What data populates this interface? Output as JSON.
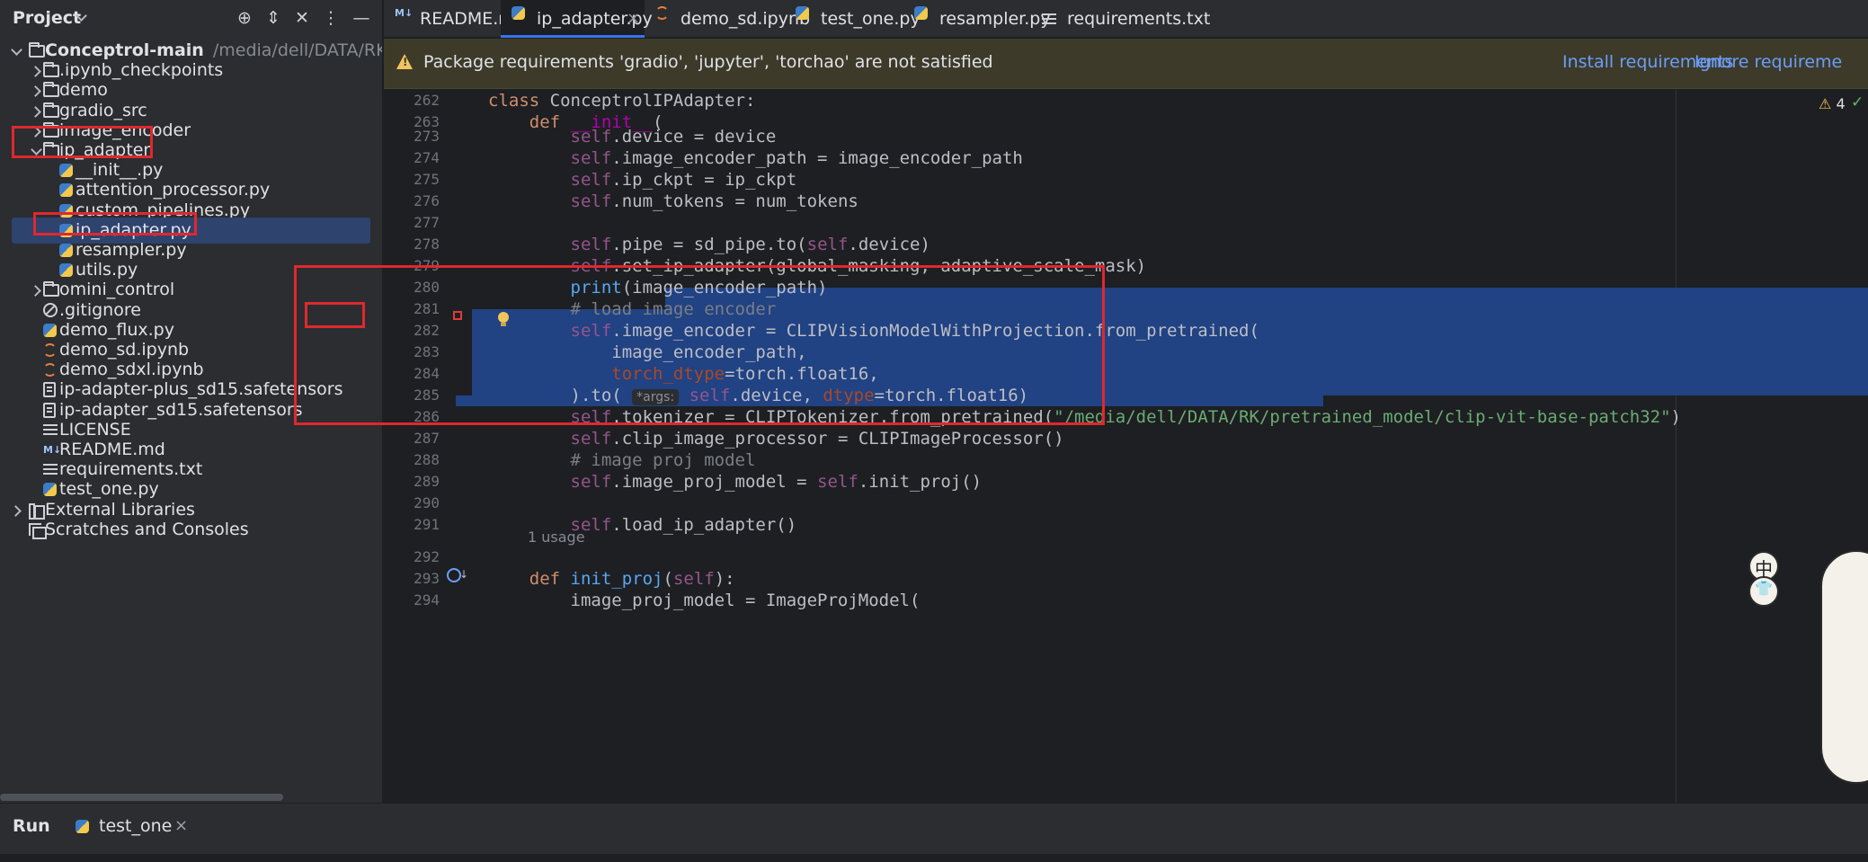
{
  "project": {
    "title": "Project",
    "tree": [
      {
        "label": "Conceptrol-main",
        "path": "/media/dell/DATA/RK/C",
        "kind": "folder",
        "level": 0,
        "arrow": "open"
      },
      {
        "label": ".ipynb_checkpoints",
        "kind": "folder",
        "level": 1,
        "arrow": "closed"
      },
      {
        "label": "demo",
        "kind": "folder",
        "level": 1,
        "arrow": "closed"
      },
      {
        "label": "gradio_src",
        "kind": "folder",
        "level": 1,
        "arrow": "closed"
      },
      {
        "label": "image_encoder",
        "kind": "folder",
        "level": 1,
        "arrow": "closed"
      },
      {
        "label": "ip_adapter",
        "kind": "folder",
        "level": 1,
        "arrow": "open"
      },
      {
        "label": "__init__.py",
        "kind": "py",
        "level": 2
      },
      {
        "label": "attention_processor.py",
        "kind": "py",
        "level": 2
      },
      {
        "label": "custom_pipelines.py",
        "kind": "py",
        "level": 2
      },
      {
        "label": "ip_adapter.py",
        "kind": "py",
        "level": 2,
        "selected": true
      },
      {
        "label": "resampler.py",
        "kind": "py",
        "level": 2
      },
      {
        "label": "utils.py",
        "kind": "py",
        "level": 2
      },
      {
        "label": "omini_control",
        "kind": "folder",
        "level": 1,
        "arrow": "closed"
      },
      {
        "label": ".gitignore",
        "kind": "ban",
        "level": 1
      },
      {
        "label": "demo_flux.py",
        "kind": "py",
        "level": 1
      },
      {
        "label": "demo_sd.ipynb",
        "kind": "nb",
        "level": 1
      },
      {
        "label": "demo_sdxl.ipynb",
        "kind": "nb",
        "level": 1
      },
      {
        "label": "ip-adapter-plus_sd15.safetensors",
        "kind": "file",
        "level": 1
      },
      {
        "label": "ip-adapter_sd15.safetensors",
        "kind": "file",
        "level": 1
      },
      {
        "label": "LICENSE",
        "kind": "lines",
        "level": 1
      },
      {
        "label": "README.md",
        "kind": "md",
        "level": 1
      },
      {
        "label": "requirements.txt",
        "kind": "lines",
        "level": 1
      },
      {
        "label": "test_one.py",
        "kind": "py",
        "level": 1
      },
      {
        "label": "External Libraries",
        "kind": "lib",
        "level": 0,
        "arrow": "closed"
      },
      {
        "label": "Scratches and Consoles",
        "kind": "scratch",
        "level": 0
      }
    ]
  },
  "tabs": [
    {
      "label": "README.md",
      "icon": "md"
    },
    {
      "label": "ip_adapter.py",
      "icon": "py",
      "active": true,
      "close": "×"
    },
    {
      "label": "demo_sd.ipynb",
      "icon": "nb"
    },
    {
      "label": "test_one.py",
      "icon": "py"
    },
    {
      "label": "resampler.py",
      "icon": "py"
    },
    {
      "label": "requirements.txt",
      "icon": "lines"
    }
  ],
  "banner": {
    "message": "Package requirements 'gradio', 'jupyter', 'torchao' are not satisfied",
    "install": "Install requirements",
    "ignore": "Ignore requireme"
  },
  "inspections": {
    "warnings": "4",
    "check": "✓"
  },
  "code": {
    "usage_label": "1 usage",
    "lines": [
      {
        "n": "262",
        "html": "<span class='kw'>class</span> ConceptrolIPAdapter:"
      },
      {
        "n": "263",
        "html": "    <span class='kw'>def</span> <span class='dunder'>__init__</span>("
      },
      {
        "n": "273",
        "html": "        <span class='self'>self</span>.device = device"
      },
      {
        "n": "274",
        "html": "        <span class='self'>self</span>.image_encoder_path = image_encoder_path"
      },
      {
        "n": "275",
        "html": "        <span class='self'>self</span>.ip_ckpt = ip_ckpt"
      },
      {
        "n": "276",
        "html": "        <span class='self'>self</span>.num_tokens = num_tokens"
      },
      {
        "n": "277",
        "html": ""
      },
      {
        "n": "278",
        "html": "        <span class='self'>self</span>.pipe = sd_pipe.to(<span class='self'>self</span>.device)"
      },
      {
        "n": "279",
        "html": "        <span class='self'>self</span>.set_ip_adapter(global_masking, adaptive_scale_mask)"
      },
      {
        "n": "280",
        "html": "        <span class='fn'>print</span>(image_encoder_path)"
      },
      {
        "n": "281",
        "html": "        <span class='cm'># load image encoder</span>"
      },
      {
        "n": "282",
        "html": "        <span class='self'>self</span>.image_encoder = CLIPVisionModelWithProjection.from_pretrained("
      },
      {
        "n": "283",
        "html": "            image_encoder_path,"
      },
      {
        "n": "284",
        "html": "            <span class='param'>torch_dtype</span>=torch.float16,"
      },
      {
        "n": "285",
        "html": "        ).to( <span class='hint'>*args:</span> <span class='self'>self</span>.device, <span class='param'>dtype</span>=torch.float16)"
      },
      {
        "n": "286",
        "html": "        <span class='self'>self</span>.tokenizer = CLIPTokenizer.from_pretrained(<span class='str'>\"/media/dell/DATA/RK/pretrained_model/clip-vit-base-patch32\"</span>)"
      },
      {
        "n": "287",
        "html": "        <span class='self'>self</span>.clip_image_processor = CLIPImageProcessor()"
      },
      {
        "n": "288",
        "html": "        <span class='cm'># image proj model</span>"
      },
      {
        "n": "289",
        "html": "        <span class='self'>self</span>.image_proj_model = <span class='self'>self</span>.init_proj()"
      },
      {
        "n": "290",
        "html": ""
      },
      {
        "n": "291",
        "html": "        <span class='self'>self</span>.load_ip_adapter()"
      },
      {
        "n": "292",
        "html": ""
      },
      {
        "n": "293",
        "html": "    <span class='kw'>def</span> <span class='fn'>init_proj</span>(<span class='self'>self</span>):"
      },
      {
        "n": "294",
        "html": "        image_proj_model = ImageProjModel("
      }
    ]
  },
  "decoration": {
    "char1": "中",
    "char2": "👕"
  },
  "run": {
    "title": "Run",
    "tab": "test_one",
    "close": "×"
  }
}
